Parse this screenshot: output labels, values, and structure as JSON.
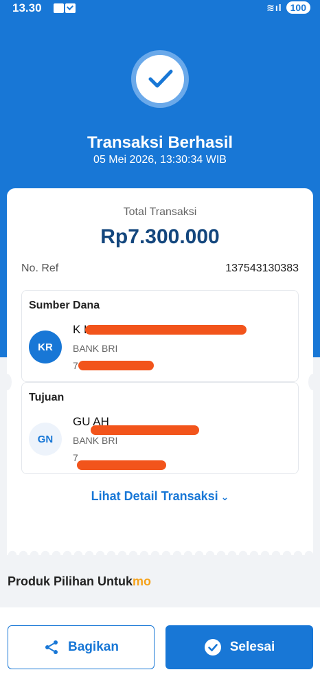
{
  "status_bar": {
    "time": "13.30",
    "battery": "100"
  },
  "header": {
    "title": "Transaksi Berhasil",
    "datetime": "05 Mei 2026, 13:30:34 WIB"
  },
  "receipt": {
    "total_label": "Total Transaksi",
    "total_amount": "Rp7.300.000",
    "ref_label": "No. Ref",
    "ref_value": "137543130383",
    "source": {
      "title": "Sumber Dana",
      "initials": "KR",
      "name": "K                        HAN",
      "bank": "BANK BRI",
      "account": "7                           3"
    },
    "destination": {
      "title": "Tujuan",
      "initials": "GN",
      "name": "GU                    AH",
      "bank": "BANK BRI",
      "account": "7"
    },
    "detail_link": "Lihat Detail Transaksi"
  },
  "products": {
    "title_prefix": "Produk Pilihan Untuk",
    "title_brand": "mo"
  },
  "actions": {
    "share_label": "Bagikan",
    "done_label": "Selesai"
  },
  "colors": {
    "primary": "#1877d6",
    "amount": "#13467d",
    "brand_orange": "#f5a21b",
    "redaction": "#f2541b"
  }
}
